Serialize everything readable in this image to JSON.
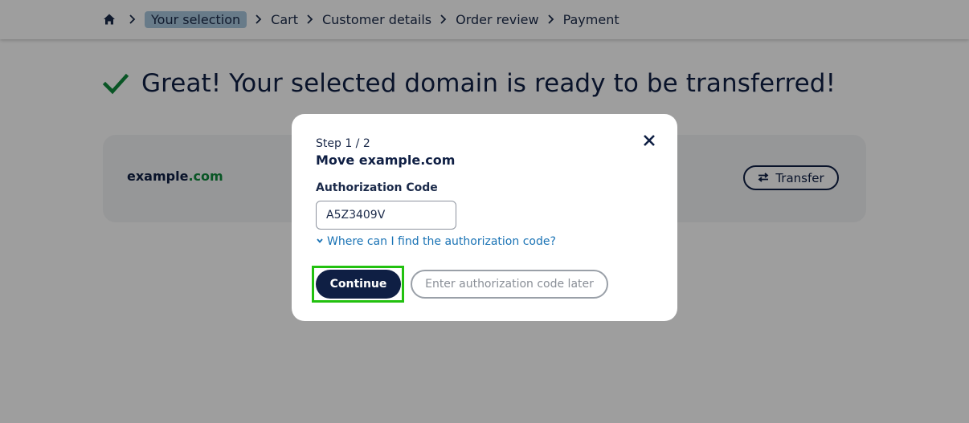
{
  "breadcrumb": {
    "home_icon": "home-icon",
    "items": [
      "Your selection",
      "Cart",
      "Customer details",
      "Order review",
      "Payment"
    ],
    "active_index": 0
  },
  "headline": {
    "icon": "checkmark-icon",
    "text": "Great! Your selected domain is ready to be transferred!"
  },
  "domain_card": {
    "name": "example",
    "tld": ".com",
    "transfer_button": "Transfer",
    "transfer_icon": "swap-arrows-icon"
  },
  "modal": {
    "step": "Step 1 / 2",
    "title": "Move example.com",
    "auth_label": "Authorization Code",
    "auth_value": "A5Z3409V",
    "help_link": "Where can I find the authorization code?",
    "continue_button": "Continue",
    "later_button": "Enter authorization code later",
    "close_icon": "close-icon"
  },
  "colors": {
    "navy": "#0f1f44",
    "success_green": "#108a3c",
    "link_blue": "#1a73b5",
    "highlight_green": "#22c10f"
  }
}
